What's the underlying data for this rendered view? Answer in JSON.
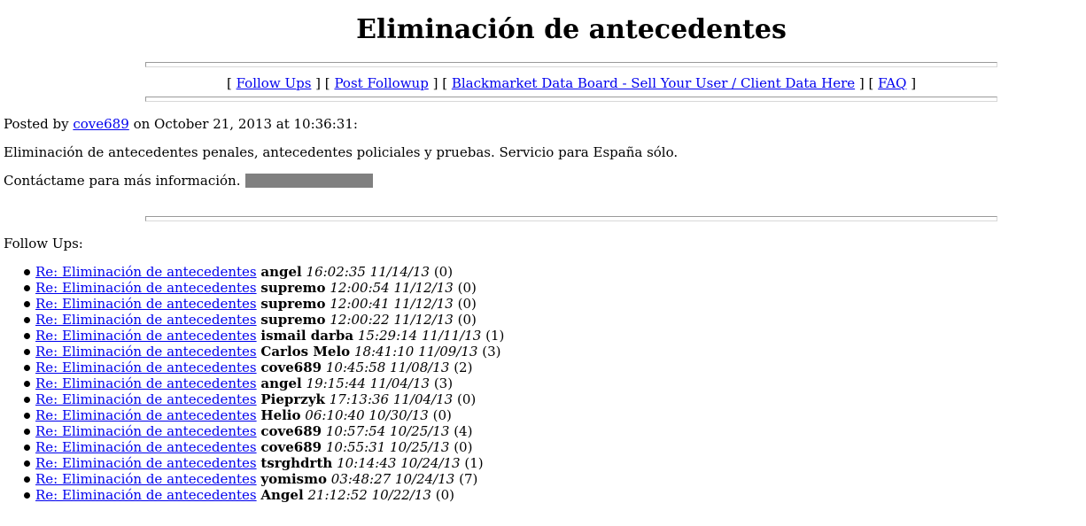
{
  "page": {
    "title": "Eliminación de antecedentes"
  },
  "nav": {
    "open_bracket": "[",
    "separator": "] [",
    "close_bracket": "]",
    "follow_ups": "Follow Ups",
    "post_followup": "Post Followup",
    "board": "Blackmarket Data Board - Sell Your User / Client Data Here",
    "faq": "FAQ"
  },
  "post": {
    "posted_by_prefix": "Posted by",
    "author": "cove689",
    "posted_on": "on October 21, 2013 at 10:36:31:",
    "body_line1": "Eliminación de antecedentes penales, antecedentes policiales y pruebas. Servicio para España sólo.",
    "body_line2": "Contáctame para más información."
  },
  "followups": {
    "heading": "Follow Ups:",
    "items": [
      {
        "title": "Re: Eliminación de antecedentes",
        "author": "angel",
        "stamp": "16:02:35 11/14/13",
        "count": "(0)"
      },
      {
        "title": "Re: Eliminación de antecedentes",
        "author": "supremo",
        "stamp": "12:00:54 11/12/13",
        "count": "(0)"
      },
      {
        "title": "Re: Eliminación de antecedentes",
        "author": "supremo",
        "stamp": "12:00:41 11/12/13",
        "count": "(0)"
      },
      {
        "title": "Re: Eliminación de antecedentes",
        "author": "supremo",
        "stamp": "12:00:22 11/12/13",
        "count": "(0)"
      },
      {
        "title": "Re: Eliminación de antecedentes",
        "author": "ismail darba",
        "stamp": "15:29:14 11/11/13",
        "count": "(1)"
      },
      {
        "title": "Re: Eliminación de antecedentes",
        "author": "Carlos Melo",
        "stamp": "18:41:10 11/09/13",
        "count": "(3)"
      },
      {
        "title": "Re: Eliminación de antecedentes",
        "author": "cove689",
        "stamp": "10:45:58 11/08/13",
        "count": "(2)"
      },
      {
        "title": "Re: Eliminación de antecedentes",
        "author": "angel",
        "stamp": "19:15:44 11/04/13",
        "count": "(3)"
      },
      {
        "title": "Re: Eliminación de antecedentes",
        "author": "Pieprzyk",
        "stamp": "17:13:36 11/04/13",
        "count": "(0)"
      },
      {
        "title": "Re: Eliminación de antecedentes",
        "author": "Helio",
        "stamp": "06:10:40 10/30/13",
        "count": "(0)"
      },
      {
        "title": "Re: Eliminación de antecedentes",
        "author": "cove689",
        "stamp": "10:57:54 10/25/13",
        "count": "(4)"
      },
      {
        "title": "Re: Eliminación de antecedentes",
        "author": "cove689",
        "stamp": "10:55:31 10/25/13",
        "count": "(0)"
      },
      {
        "title": "Re: Eliminación de antecedentes",
        "author": "tsrghdrth",
        "stamp": "10:14:43 10/24/13",
        "count": "(1)"
      },
      {
        "title": "Re: Eliminación de antecedentes",
        "author": "yomismo",
        "stamp": "03:48:27 10/24/13",
        "count": "(7)"
      },
      {
        "title": "Re: Eliminación de antecedentes",
        "author": "Angel",
        "stamp": "21:12:52 10/22/13",
        "count": "(0)"
      }
    ]
  }
}
